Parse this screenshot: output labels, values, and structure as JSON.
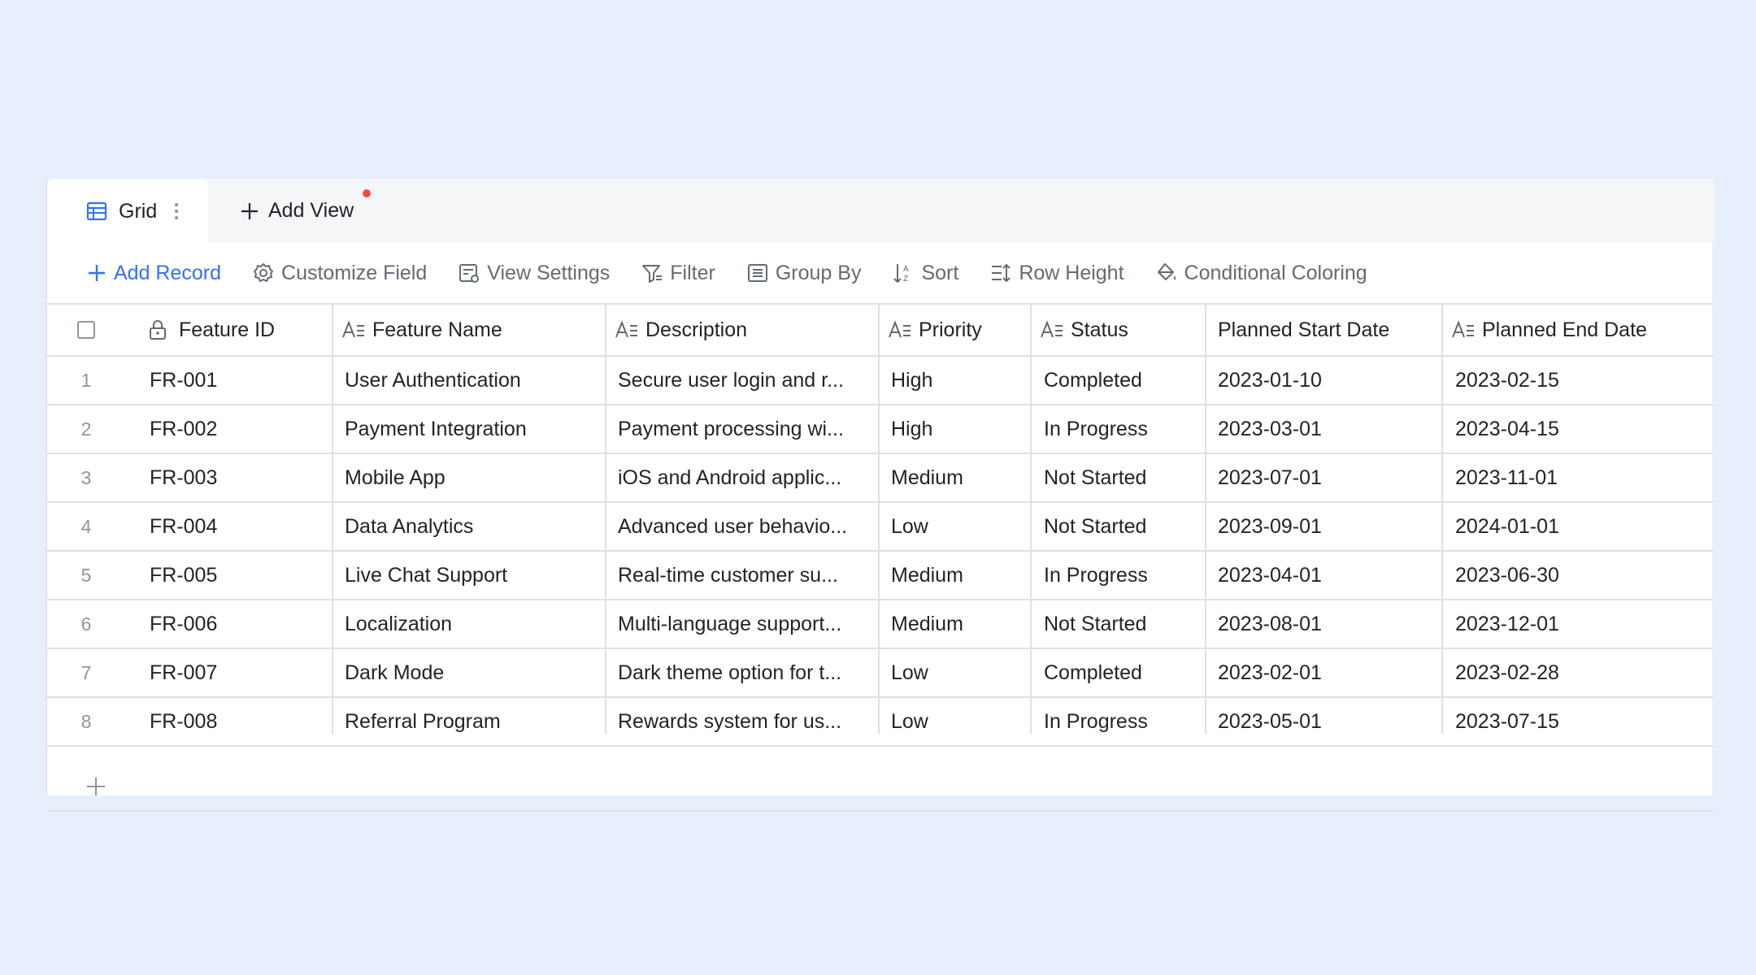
{
  "tabs": {
    "active": {
      "label": "Grid",
      "icon": "table-grid-icon"
    },
    "add_view": {
      "label": "Add View",
      "icon": "plus-icon",
      "notification": true
    }
  },
  "toolbar": {
    "add_record": "Add Record",
    "customize_field": "Customize Field",
    "view_settings": "View Settings",
    "filter": "Filter",
    "group_by": "Group By",
    "sort": "Sort",
    "row_height": "Row Height",
    "conditional_coloring": "Conditional Coloring"
  },
  "colors": {
    "accent": "#3370ff",
    "background": "#e8effc",
    "notification_dot": "#f54a45"
  },
  "columns": [
    {
      "key": "id",
      "label": "Feature ID",
      "icon": "lock-icon"
    },
    {
      "key": "name",
      "label": "Feature Name",
      "icon": "text-field-icon"
    },
    {
      "key": "description",
      "label": "Description",
      "icon": "text-field-icon"
    },
    {
      "key": "priority",
      "label": "Priority",
      "icon": "text-field-icon"
    },
    {
      "key": "status",
      "label": "Status",
      "icon": "text-field-icon"
    },
    {
      "key": "start",
      "label": "Planned Start Date",
      "icon": ""
    },
    {
      "key": "end",
      "label": "Planned End Date",
      "icon": "text-field-icon"
    }
  ],
  "rows": [
    {
      "num": "1",
      "id": "FR-001",
      "name": "User Authentication",
      "description": "Secure user login and r...",
      "priority": "High",
      "status": "Completed",
      "start": "2023-01-10",
      "end": "2023-02-15"
    },
    {
      "num": "2",
      "id": "FR-002",
      "name": "Payment Integration",
      "description": "Payment processing wi...",
      "priority": "High",
      "status": "In Progress",
      "start": "2023-03-01",
      "end": "2023-04-15"
    },
    {
      "num": "3",
      "id": "FR-003",
      "name": "Mobile App",
      "description": "iOS and Android applic...",
      "priority": "Medium",
      "status": "Not Started",
      "start": "2023-07-01",
      "end": "2023-11-01"
    },
    {
      "num": "4",
      "id": "FR-004",
      "name": "Data Analytics",
      "description": "Advanced user behavio...",
      "priority": "Low",
      "status": "Not Started",
      "start": "2023-09-01",
      "end": "2024-01-01"
    },
    {
      "num": "5",
      "id": "FR-005",
      "name": "Live Chat Support",
      "description": "Real-time customer su...",
      "priority": "Medium",
      "status": "In Progress",
      "start": "2023-04-01",
      "end": "2023-06-30"
    },
    {
      "num": "6",
      "id": "FR-006",
      "name": "Localization",
      "description": "Multi-language support...",
      "priority": "Medium",
      "status": "Not Started",
      "start": "2023-08-01",
      "end": "2023-12-01"
    },
    {
      "num": "7",
      "id": "FR-007",
      "name": "Dark Mode",
      "description": "Dark theme option for t...",
      "priority": "Low",
      "status": "Completed",
      "start": "2023-02-01",
      "end": "2023-02-28"
    },
    {
      "num": "8",
      "id": "FR-008",
      "name": "Referral Program",
      "description": "Rewards system for us...",
      "priority": "Low",
      "status": "In Progress",
      "start": "2023-05-01",
      "end": "2023-07-15"
    }
  ]
}
